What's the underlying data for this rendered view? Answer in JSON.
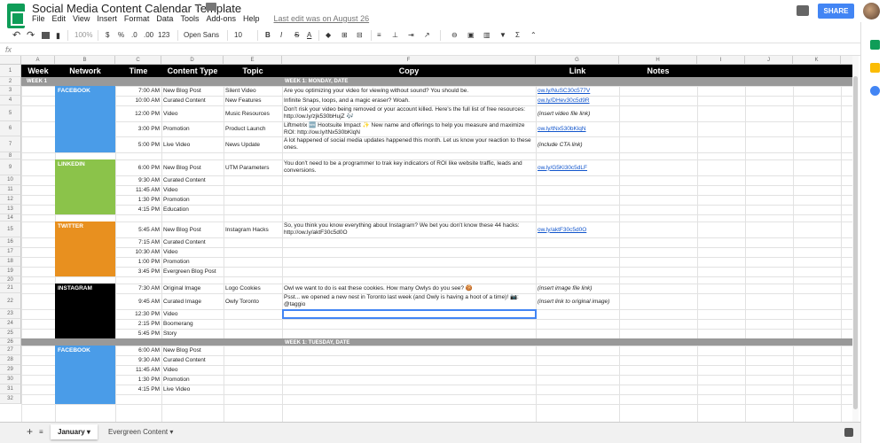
{
  "app": {
    "title": "Social Media Content Calendar Template",
    "menu": [
      "File",
      "Edit",
      "View",
      "Insert",
      "Format",
      "Data",
      "Tools",
      "Add-ons",
      "Help"
    ],
    "last_edit": "Last edit was on August 26",
    "share_label": "SHARE"
  },
  "toolbar": {
    "zoom": "100%",
    "currency": "$",
    "percent": "%",
    "dec_less": ".0",
    "dec_more": ".00",
    "number_format": "123",
    "font": "Open Sans",
    "font_size": "10",
    "bold": "B",
    "italic": "I",
    "strike": "S",
    "text_color": "A"
  },
  "formula": {
    "fx": "fx"
  },
  "columns": [
    "A",
    "B",
    "C",
    "D",
    "E",
    "F",
    "G",
    "H",
    "I",
    "J",
    "K"
  ],
  "header": [
    "Week",
    "Network",
    "Time",
    "Content Type",
    "Topic",
    "Copy",
    "Link",
    "Notes"
  ],
  "week1_label": "WEEK 1",
  "day1": "WEEK 1: MONDAY, DATE",
  "day2": "WEEK 1: TUESDAY, DATE",
  "networks": {
    "facebook": "FACEBOOK",
    "linkedin": "LINKEDIN",
    "twitter": "TWITTER",
    "instagram": "INSTAGRAM"
  },
  "row_numbers": [
    "1",
    "2",
    "3",
    "4",
    "5",
    "6",
    "7",
    "8",
    "9",
    "10",
    "11",
    "12",
    "13",
    "14",
    "15",
    "16",
    "17",
    "18",
    "19",
    "20",
    "21",
    "22",
    "23",
    "24",
    "25",
    "26",
    "27",
    "28",
    "29",
    "30",
    "31",
    "32"
  ],
  "rows": {
    "r3": {
      "time": "7:00 AM",
      "type": "New Blog Post",
      "topic": "Silent Video",
      "copy": "Are you optimizing your video for viewing without sound? You should be.",
      "link": "http://ow.ly/NuSC30c577V"
    },
    "r4": {
      "time": "10:00 AM",
      "type": "Curated Content",
      "topic": "New Features",
      "copy": "Infinite Snaps, loops, and a magic eraser? Woah.",
      "link": "http://ow.ly/DHev30c5d9R"
    },
    "r5": {
      "time": "12:00 PM",
      "type": "Video",
      "topic": "Music Resources",
      "copy": "Don't risk your video being removed or your account killed. Here's the full list of free resources: http://ow.ly/zjk530bHujZ 🎶",
      "link": "(insert video file link)"
    },
    "r6": {
      "time": "3:00 PM",
      "type": "Promotion",
      "topic": "Product Launch",
      "copy": "Liftmetrix 🆕 Hootsuite Impact ✨ New name and offerings to help you measure and maximize ROI: http://ow.ly/tNx530bKlqN",
      "link": "http://ow.ly/tNx530bKlqN"
    },
    "r7": {
      "time": "5:00 PM",
      "type": "Live Video",
      "topic": "News Update",
      "copy": "A lot happened of social media updates happened this month. Let us know your reaction to these ones.",
      "link": "(include CTA link)"
    },
    "r9": {
      "time": "6:00 PM",
      "type": "New Blog Post",
      "topic": "UTM Parameters",
      "copy": "You don't need to be a programmer to trak key indicators of ROI like website traffic, leads and conversions.",
      "link": "http://ow.ly/G5Kl30c5dLF"
    },
    "r10": {
      "time": "9:30 AM",
      "type": "Curated Content"
    },
    "r11": {
      "time": "11:45 AM",
      "type": "Video"
    },
    "r12": {
      "time": "1:30 PM",
      "type": "Promotion"
    },
    "r13": {
      "time": "4:15 PM",
      "type": "Education"
    },
    "r15": {
      "time": "5:45 AM",
      "type": "New Blog Post",
      "topic": "Instagram Hacks",
      "copy": "So, you think you know everything about Instagram? We bet you don't know these 44 hacks: http://ow.ly/aktF30c5d0O",
      "link": "http://ow.ly/aktF30c5d0O"
    },
    "r16": {
      "time": "7:15 AM",
      "type": "Curated Content"
    },
    "r17": {
      "time": "10:30 AM",
      "type": "Video"
    },
    "r18": {
      "time": "1:00 PM",
      "type": "Promotion"
    },
    "r19": {
      "time": "3:45 PM",
      "type": "Evergreen Blog Post"
    },
    "r21": {
      "time": "7:30 AM",
      "type": "Original Image",
      "topic": "Logo Cookies",
      "copy": "Owl we want to do is eat these cookies. How many Owlys do you see? 🍪",
      "link": "(insert image file link)"
    },
    "r22": {
      "time": "9:45 AM",
      "type": "Curated Image",
      "topic": "Owly Toronto",
      "copy": "Psst... we opened a new nest in Toronto last week (and Owly is having a hoot of a time)! 📷: @taggio",
      "link": "(insert link to original image)"
    },
    "r23": {
      "time": "12:30 PM",
      "type": "Video"
    },
    "r24": {
      "time": "2:15 PM",
      "type": "Boomerang"
    },
    "r25": {
      "time": "5:45 PM",
      "type": "Story"
    },
    "r28": {
      "time": "6:00 AM",
      "type": "New Blog Post"
    },
    "r29": {
      "time": "9:30 AM",
      "type": "Curated Content"
    },
    "r30": {
      "time": "11:45 AM",
      "type": "Video"
    },
    "r31": {
      "time": "1:30 PM",
      "type": "Promotion"
    },
    "r32": {
      "time": "4:15 PM",
      "type": "Live Video"
    }
  },
  "tabs": {
    "add": "+",
    "list": "≡",
    "january": "January",
    "evergreen": "Evergreen Content"
  },
  "colors": {
    "facebook": "#4a9ce8",
    "linkedin": "#8bc34a",
    "twitter": "#e8901f",
    "instagram": "#000000",
    "share": "#4285f4",
    "sheets": "#0f9d58"
  }
}
